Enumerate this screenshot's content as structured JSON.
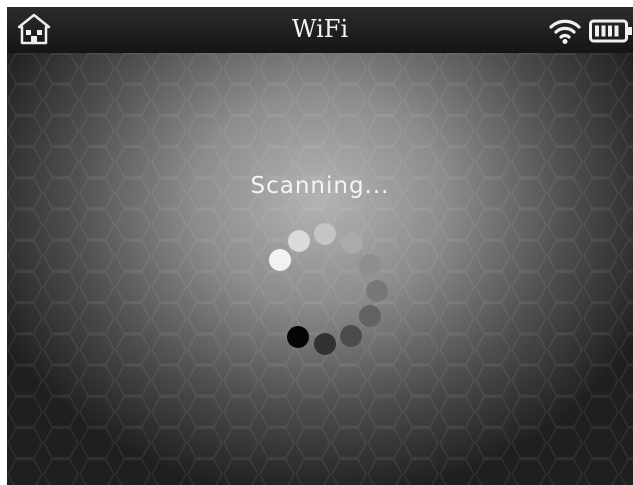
{
  "header": {
    "title": "WiFi",
    "home_icon": "home-icon",
    "wifi_icon": "wifi-signal-icon",
    "battery_icon": "battery-icon"
  },
  "main": {
    "status_text": "Scanning..."
  },
  "spinner": {
    "dot_colors": [
      "#f2f2f2",
      "#dadada",
      "#c4c4c4",
      "#aaaaaa",
      "#8e8e8e",
      "#787878",
      "#636363",
      "#4c4c4c",
      "#323232",
      "#1c1c1c",
      "#050505"
    ]
  },
  "colors": {
    "header_bg": "#1e1e1e",
    "text": "#f4f4f4"
  }
}
